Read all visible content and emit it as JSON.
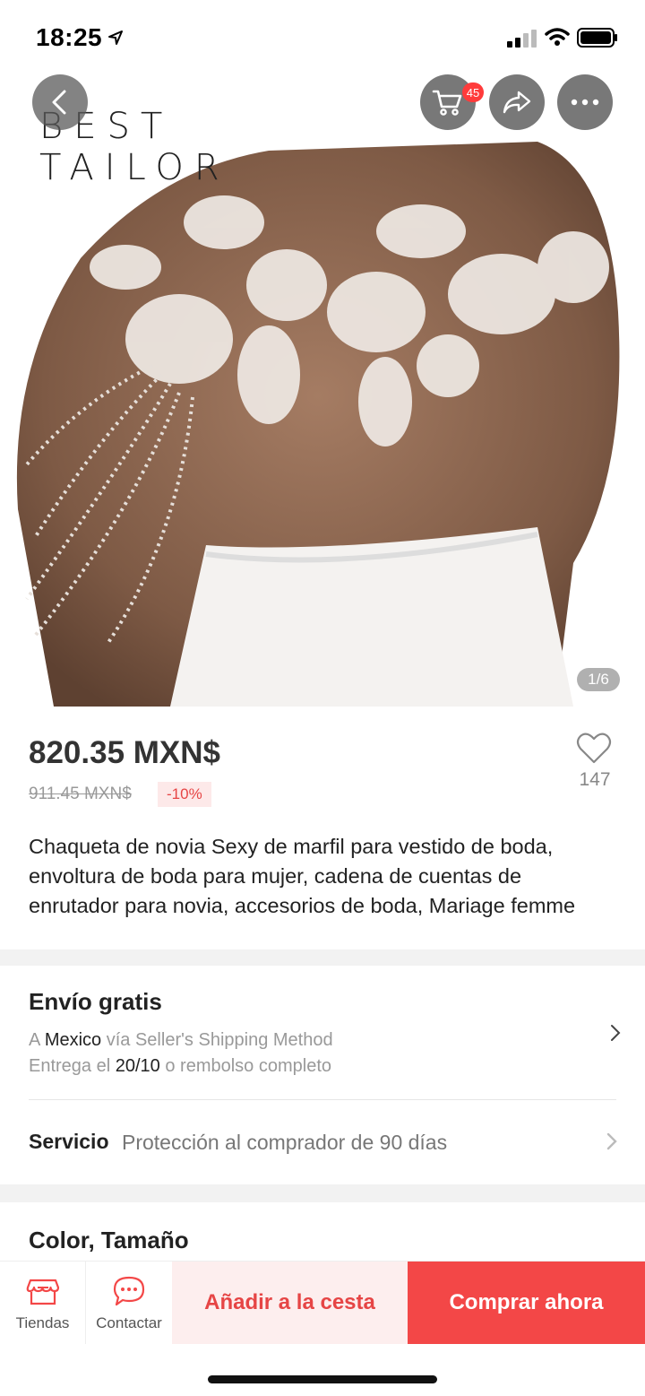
{
  "status_bar": {
    "time": "18:25"
  },
  "hero": {
    "brand_line1": "BEST",
    "brand_line2": "TAILOR",
    "cart_count": "45",
    "image_counter": "1/6"
  },
  "product": {
    "price": "820.35 MXN$",
    "original_price": "911.45 MXN$",
    "discount": "-10%",
    "wishlist_count": "147",
    "title": "Chaqueta de novia Sexy de marfil para vestido de boda, envoltura de boda para mujer, cadena de cuentas de enrutador para novia, accesorios de boda, Mariage femme"
  },
  "shipping": {
    "title": "Envío gratis",
    "line1_prefix": "A",
    "line1_country": "Mexico",
    "line1_suffix": "vía Seller's Shipping Method",
    "line2_prefix": "Entrega el",
    "line2_date": "20/10",
    "line2_suffix": "o rembolso completo"
  },
  "service": {
    "label": "Servicio",
    "text": "Protección al comprador de 90 días"
  },
  "options": {
    "title": "Color, Tamaño"
  },
  "bottom_bar": {
    "stores_label": "Tiendas",
    "contact_label": "Contactar",
    "add_to_cart": "Añadir a la cesta",
    "buy_now": "Comprar ahora"
  },
  "colors": {
    "accent": "#f34747",
    "accent_light": "#fdeeee"
  }
}
